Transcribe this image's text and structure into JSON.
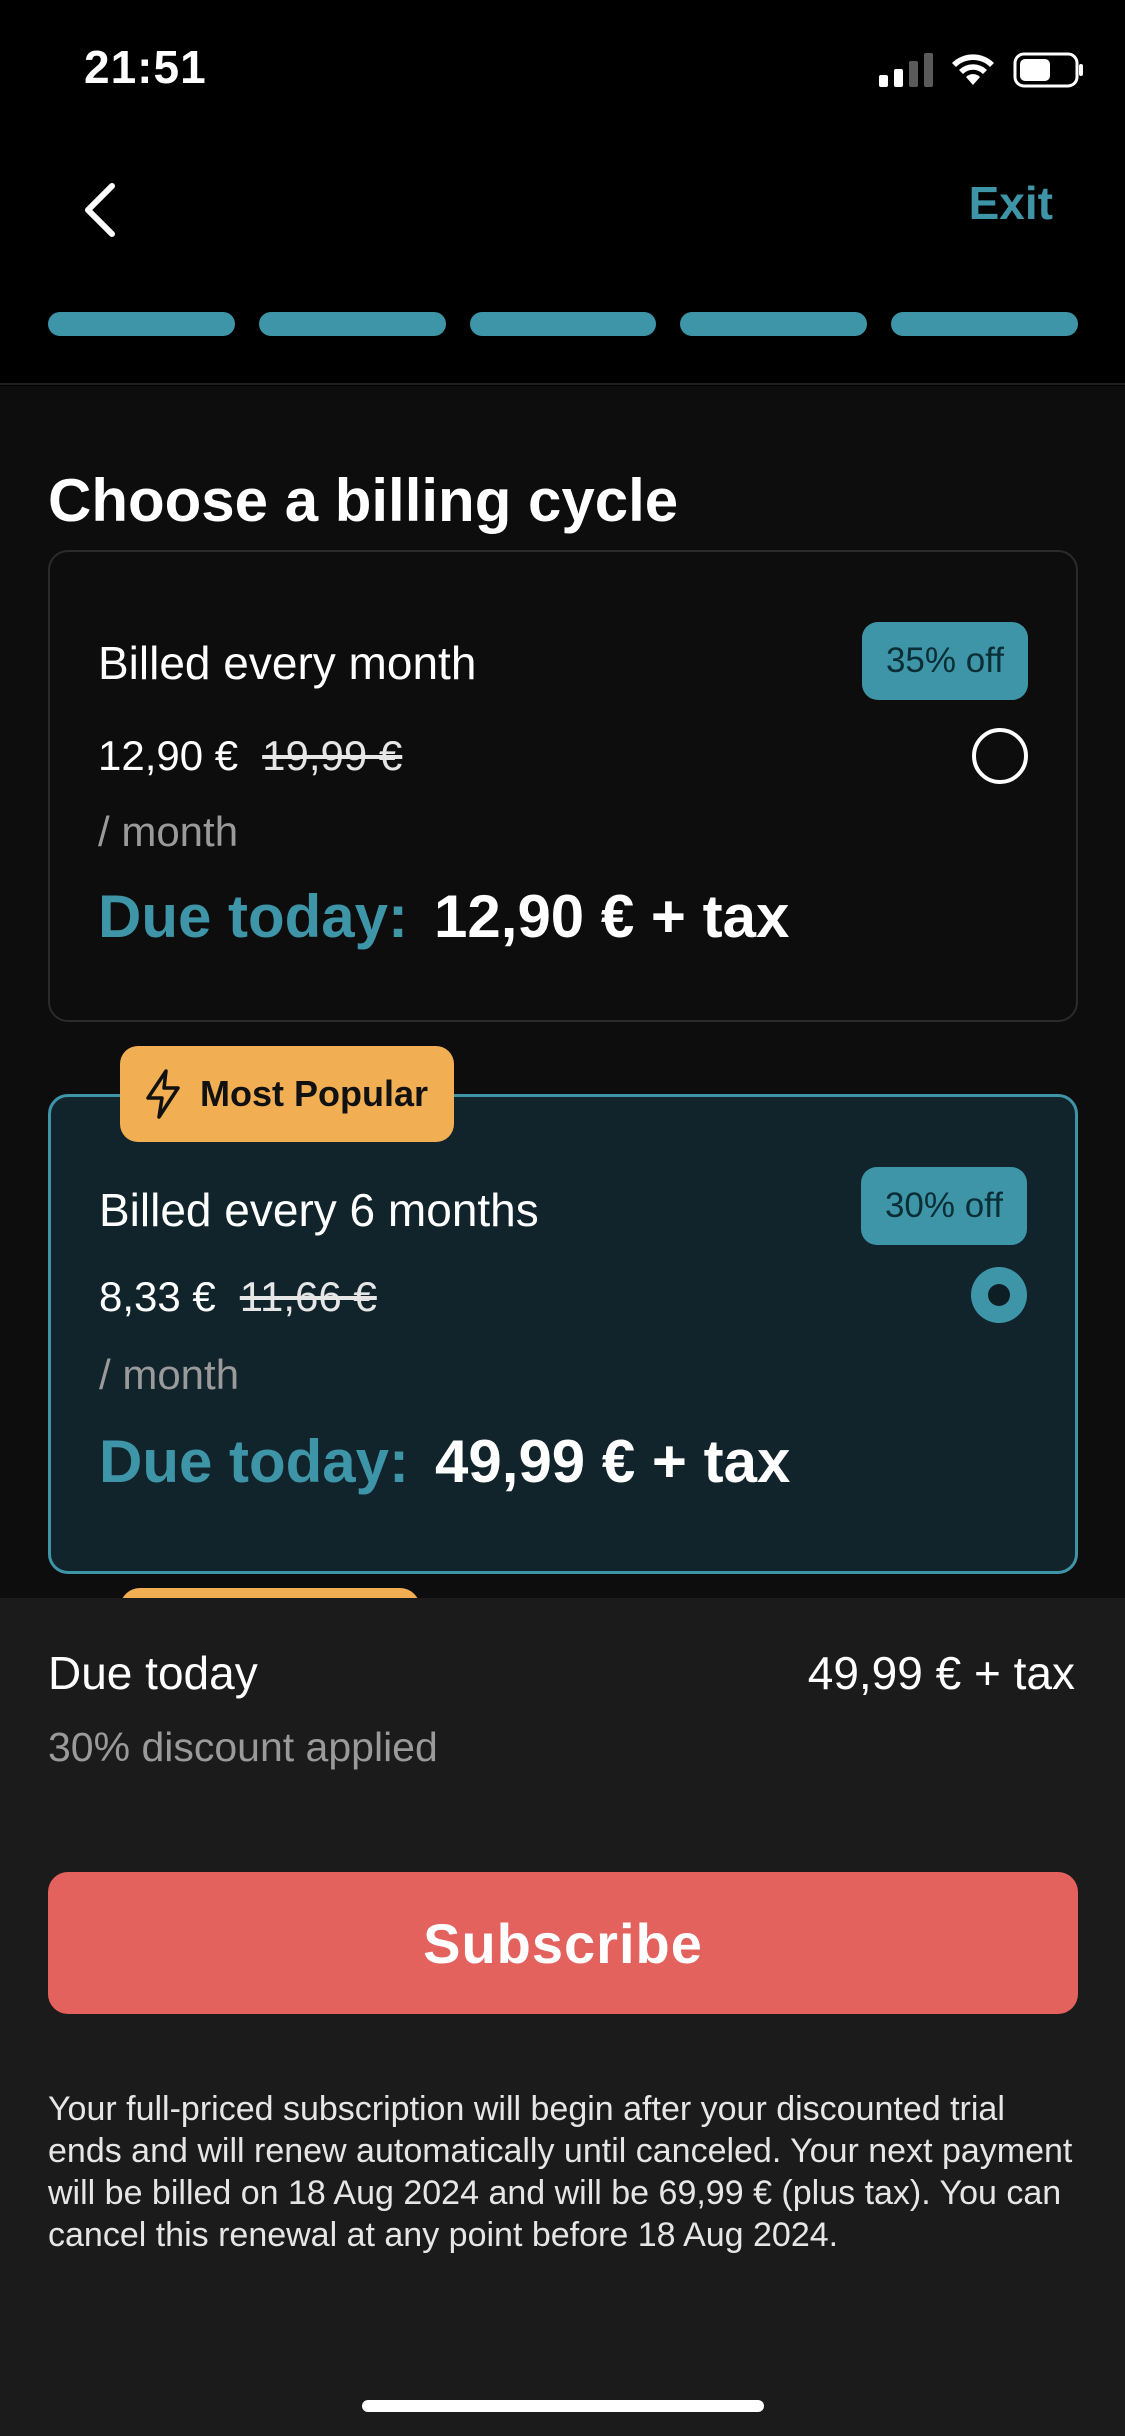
{
  "status_bar": {
    "time": "21:51"
  },
  "nav": {
    "exit_label": "Exit",
    "progress_segments": 5
  },
  "page": {
    "title": "Choose a billing cycle"
  },
  "plans": [
    {
      "name": "Billed every month",
      "badge": "35% off",
      "price": "12,90 €",
      "old_price": "19,99 €",
      "per": "/ month",
      "due_label": "Due today:",
      "due_amount": "12,90 € + tax",
      "selected": false
    },
    {
      "tag": "Most Popular",
      "name": "Billed every 6 months",
      "badge": "30% off",
      "price": "8,33 €",
      "old_price": "11,66 €",
      "per": "/ month",
      "due_label": "Due today:",
      "due_amount": "49,99 € + tax",
      "selected": true
    }
  ],
  "footer": {
    "due_label": "Due today",
    "due_amount": "49,99 € + tax",
    "discount_note": "30% discount applied",
    "subscribe_label": "Subscribe",
    "legal": "Your full-priced subscription will begin after your discounted trial ends and will renew automatically until canceled. Your next payment will be billed on 18 Aug 2024 and will be 69,99 € (plus tax). You can cancel this renewal at any point before 18 Aug 2024."
  },
  "colors": {
    "accent": "#3f95a8",
    "popular": "#f2ae52",
    "subscribe": "#e4625e",
    "background": "#0d0d0d"
  },
  "icons": [
    "back-chevron-icon",
    "lightning-icon",
    "signal-icon",
    "wifi-icon",
    "battery-icon"
  ]
}
